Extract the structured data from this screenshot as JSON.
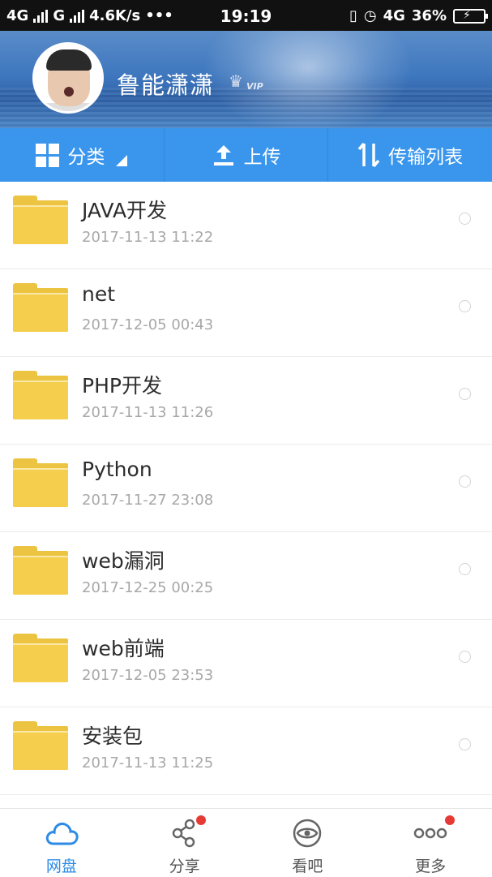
{
  "status_bar": {
    "left_text_1": "4G",
    "left_text_2": "G",
    "speed": "4.6K/s",
    "dots": "•••",
    "time": "19:19",
    "network": "4G",
    "battery": "36%"
  },
  "profile": {
    "username": "鲁能潇潇",
    "badge": "VIP"
  },
  "toolbar": {
    "category_label": "分类",
    "upload_label": "上传",
    "transfer_label": "传输列表"
  },
  "files": [
    {
      "name": "JAVA开发",
      "date": "2017-11-13  11:22"
    },
    {
      "name": "net",
      "date": "2017-12-05  00:43"
    },
    {
      "name": "PHP开发",
      "date": "2017-11-13  11:26"
    },
    {
      "name": "Python",
      "date": "2017-11-27  23:08"
    },
    {
      "name": "web漏洞",
      "date": "2017-12-25  00:25"
    },
    {
      "name": "web前端",
      "date": "2017-12-05  23:53"
    },
    {
      "name": "安装包",
      "date": "2017-11-13  11:25"
    }
  ],
  "bottom_nav": {
    "items": [
      {
        "label": "网盘",
        "icon": "cloud-icon",
        "active": true
      },
      {
        "label": "分享",
        "icon": "share-icon",
        "badge": true
      },
      {
        "label": "看吧",
        "icon": "eye-icon"
      },
      {
        "label": "更多",
        "icon": "more-icon",
        "badge": true
      }
    ]
  },
  "colors": {
    "accent": "#3a96ec",
    "folder": "#f4ce4c",
    "badge": "#e63a35",
    "active_nav": "#2d8be6"
  }
}
